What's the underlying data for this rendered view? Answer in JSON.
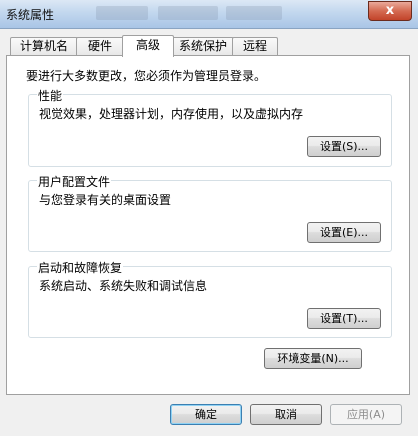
{
  "window": {
    "title": "系统属性",
    "close_symbol": "x"
  },
  "tabs": [
    {
      "label": "计算机名"
    },
    {
      "label": "硬件"
    },
    {
      "label": "高级"
    },
    {
      "label": "系统保护"
    },
    {
      "label": "远程"
    }
  ],
  "notice": "要进行大多数更改，您必须作为管理员登录。",
  "groups": {
    "performance": {
      "title": "性能",
      "desc": "视觉效果，处理器计划，内存使用，以及虚拟内存",
      "button": "设置(S)..."
    },
    "profiles": {
      "title": "用户配置文件",
      "desc": "与您登录有关的桌面设置",
      "button": "设置(E)..."
    },
    "startup": {
      "title": "启动和故障恢复",
      "desc": "系统启动、系统失败和调试信息",
      "button": "设置(T)..."
    }
  },
  "env_button": "环境变量(N)...",
  "footer": {
    "ok": "确定",
    "cancel": "取消",
    "apply": "应用(A)"
  }
}
